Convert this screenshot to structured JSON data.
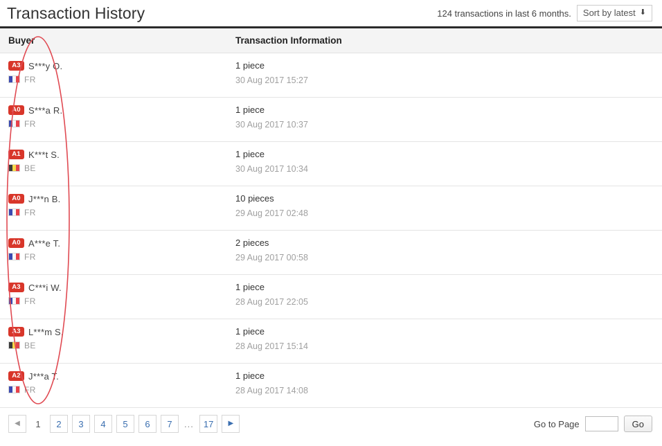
{
  "header": {
    "title": "Transaction History",
    "summary": "124 transactions in last 6 months.",
    "sort_label": "Sort by latest",
    "sort_caret_icon": "caret-down-icon"
  },
  "table": {
    "columns": [
      "Buyer",
      "Transaction Information"
    ],
    "rows": [
      {
        "rank": "A3",
        "name": "S***y O.",
        "country": "FR",
        "flag_icon": "flag-fr-icon",
        "quantity": "1 piece",
        "date": "30 Aug 2017 15:27"
      },
      {
        "rank": "A0",
        "name": "S***a R.",
        "country": "FR",
        "flag_icon": "flag-fr-icon",
        "quantity": "1 piece",
        "date": "30 Aug 2017 10:37"
      },
      {
        "rank": "A1",
        "name": "K***t S.",
        "country": "BE",
        "flag_icon": "flag-be-icon",
        "quantity": "1 piece",
        "date": "30 Aug 2017 10:34"
      },
      {
        "rank": "A0",
        "name": "J***n B.",
        "country": "FR",
        "flag_icon": "flag-fr-icon",
        "quantity": "10 pieces",
        "date": "29 Aug 2017 02:48"
      },
      {
        "rank": "A0",
        "name": "A***e T.",
        "country": "FR",
        "flag_icon": "flag-fr-icon",
        "quantity": "2 pieces",
        "date": "29 Aug 2017 00:58"
      },
      {
        "rank": "A3",
        "name": "C***i W.",
        "country": "FR",
        "flag_icon": "flag-fr-icon",
        "quantity": "1 piece",
        "date": "28 Aug 2017 22:05"
      },
      {
        "rank": "A3",
        "name": "L***m S.",
        "country": "BE",
        "flag_icon": "flag-be-icon",
        "quantity": "1 piece",
        "date": "28 Aug 2017 15:14"
      },
      {
        "rank": "A2",
        "name": "J***a T.",
        "country": "FR",
        "flag_icon": "flag-fr-icon",
        "quantity": "1 piece",
        "date": "28 Aug 2017 14:08"
      }
    ]
  },
  "pagination": {
    "prev_icon": "triangle-left-icon",
    "next_icon": "triangle-right-icon",
    "current_page": "1",
    "pages": [
      "2",
      "3",
      "4",
      "5",
      "6",
      "7"
    ],
    "ellipsis": "...",
    "last_page": "17",
    "goto_label": "Go to Page",
    "goto_value": "",
    "goto_placeholder": "",
    "go_button": "Go"
  },
  "annotation": {
    "shape": "ellipse",
    "color": "#e04a52",
    "target": "buyer-column"
  }
}
